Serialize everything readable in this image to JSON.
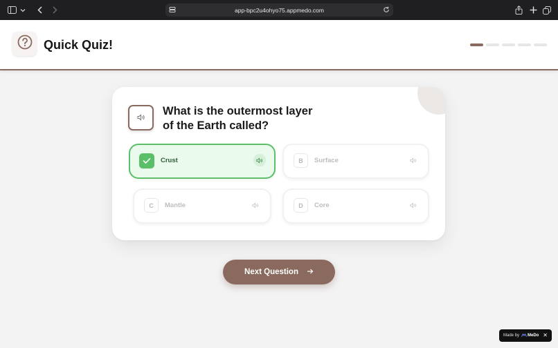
{
  "browser": {
    "url": "app-bpc2u4ohyo75.appmedo.com"
  },
  "header": {
    "title": "Quick Quiz!",
    "progress": {
      "current": 1,
      "total": 5
    },
    "accent_color": "#8a6a5e"
  },
  "quiz": {
    "question": "What is the outermost layer of the Earth called?",
    "options": [
      {
        "letter": "A",
        "label": "Crust",
        "selected": true
      },
      {
        "letter": "B",
        "label": "Surface",
        "selected": false
      },
      {
        "letter": "C",
        "label": "Mantle",
        "selected": false
      },
      {
        "letter": "D",
        "label": "Core",
        "selected": false
      }
    ],
    "selected_color": "#5bbf6a"
  },
  "next_button": {
    "label": "Next Question"
  },
  "badge": {
    "made_by": "Made by",
    "brand": "MeDo",
    "close": "✕"
  },
  "icons": {
    "logo": "question-circle-icon",
    "audio": "speaker-icon",
    "check": "check-icon",
    "next": "arrow-right-icon"
  }
}
